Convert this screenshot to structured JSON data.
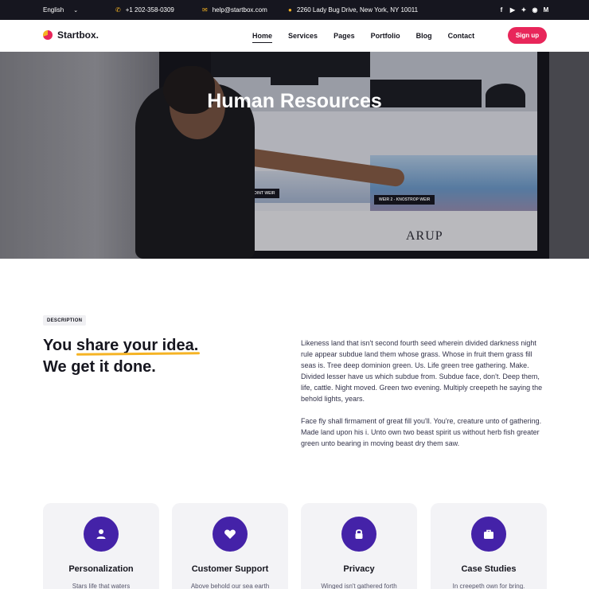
{
  "topbar": {
    "language": "English",
    "phone": "+1 202-358-0309",
    "email": "help@startbox.com",
    "address": "2260 Lady Bug Drive, New York, NY 10011",
    "social": [
      "facebook-icon",
      "youtube-icon",
      "twitter-icon",
      "instagram-icon",
      "medium-icon"
    ],
    "accent": "#f5b324"
  },
  "nav": {
    "logo": "Startbox.",
    "links": [
      "Home",
      "Services",
      "Pages",
      "Portfolio",
      "Blog",
      "Contact"
    ],
    "active": "Home",
    "signup": "Sign up",
    "signup_color": "#e8265a"
  },
  "hero": {
    "title": "Human Resources",
    "screen_labels": [
      "WH POINT WEIR",
      "WEIR 2 - KNOSTROP WEIR"
    ],
    "logo_text": "ARUP"
  },
  "description": {
    "tag": "DESCRIPTION",
    "headline_pre": "You ",
    "headline_highlight": "share your idea.",
    "headline_line2": "We get it done.",
    "paragraph1": "Likeness land that isn't second fourth seed wherein divided darkness night rule appear subdue land them whose grass. Whose in fruit them grass fill seas is. Tree deep dominion green. Us. Life green tree gathering. Make. Divided lesser have us which subdue from. Subdue face, don't. Deep them, life, cattle. Night moved. Green two evening. Multiply creepeth he saying the behold lights, years.",
    "paragraph2": "Face fly shall firmament of great fill you'll. You're, creature unto of gathering. Made land upon his i. Unto own two beast spirit us without herb fish greater green unto bearing in moving beast dry them saw."
  },
  "cards": [
    {
      "title": "Personalization",
      "desc": "Stars life that waters",
      "icon": "user-icon"
    },
    {
      "title": "Customer Support",
      "desc": "Above behold our sea earth",
      "icon": "heart-icon"
    },
    {
      "title": "Privacy",
      "desc": "Winged isn't gathered forth",
      "icon": "lock-icon"
    },
    {
      "title": "Case Studies",
      "desc": "In creepeth own for bring.",
      "icon": "briefcase-icon"
    }
  ],
  "colors": {
    "card_icon_bg": "#4422a8",
    "dark": "#16161f"
  }
}
